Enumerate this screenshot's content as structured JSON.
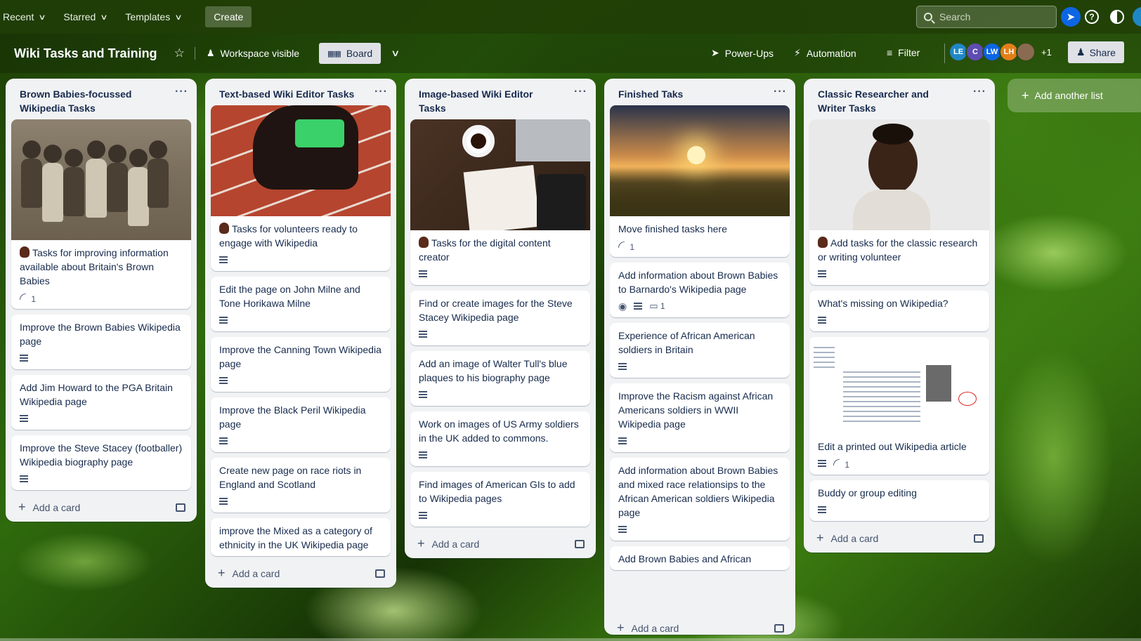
{
  "topbar": {
    "nav": [
      {
        "label": "Recent"
      },
      {
        "label": "Starred"
      },
      {
        "label": "Templates"
      }
    ],
    "create_label": "Create",
    "search_placeholder": "Search"
  },
  "board": {
    "title": "Wiki Tasks and Training",
    "visibility_label": "Workspace visible",
    "view_label": "Board",
    "powerups_label": "Power-Ups",
    "automation_label": "Automation",
    "filter_label": "Filter",
    "members": [
      {
        "initials": "LE",
        "color": "#1e88c7"
      },
      {
        "initials": "C",
        "color": "#5e4db2"
      },
      {
        "initials": "LW",
        "color": "#0c66e4"
      },
      {
        "initials": "LH",
        "color": "#e2801a"
      },
      {
        "initials": "",
        "color": "#8a6b52"
      }
    ],
    "more_members": "+1",
    "share_label": "Share",
    "add_list_label": "Add another list"
  },
  "lists": [
    {
      "title": "Brown Babies-focussed Wikipedia Tasks",
      "add_card_label": "Add a card",
      "cards": [
        {
          "text": "Tasks for improving information available about Britain's Brown Babies",
          "cover": "sepia",
          "hand": true,
          "attachments": "1"
        },
        {
          "text": "Improve the Brown Babies Wikipedia page",
          "description": true
        },
        {
          "text": "Add Jim Howard to the PGA Britain Wikipedia page",
          "description": true
        },
        {
          "text": "Improve the Steve Stacey (footballer) Wikipedia biography page",
          "description": true
        }
      ]
    },
    {
      "title": "Text-based Wiki Editor Tasks",
      "add_card_label": "Add a card",
      "cards": [
        {
          "text": "Tasks for volunteers ready to engage with Wikipedia",
          "cover": "track",
          "hand": true,
          "description": true
        },
        {
          "text": "Edit the page on John Milne and Tone Horikawa Milne",
          "description": true
        },
        {
          "text": "Improve the Canning Town Wikipedia page",
          "description": true
        },
        {
          "text": "Improve the Black Peril Wikipedia page",
          "description": true
        },
        {
          "text": "Create new page on race riots in England and Scotland",
          "description": true
        },
        {
          "text": "improve the Mixed as a category of ethnicity in the UK Wikipedia page"
        }
      ]
    },
    {
      "title": "Image-based Wiki Editor Tasks",
      "add_card_label": "Add a card",
      "cards": [
        {
          "text": "Tasks for the digital content creator",
          "cover": "desk",
          "hand": true,
          "description": true
        },
        {
          "text": "Find or create images for the Steve Stacey Wikipedia page",
          "description": true
        },
        {
          "text": "Add an image of Walter Tull's blue plaques to his biography page",
          "description": true
        },
        {
          "text": "Work on images of US Army soldiers in the UK added to commons.",
          "description": true
        },
        {
          "text": "Find images of American GIs to add to Wikipedia pages",
          "description": true
        }
      ]
    },
    {
      "title": "Finished Taks",
      "add_card_label": "Add a card",
      "cards": [
        {
          "text": "Move finished tasks here",
          "cover": "sunset",
          "attachments": "1"
        },
        {
          "text": "Add information about Brown Babies to Barnardo's Wikipedia page",
          "watch": true,
          "description": true,
          "comments": "1"
        },
        {
          "text": "Experience of African American soldiers in Britain",
          "description": true
        },
        {
          "text": "Improve the Racism against African Americans soldiers in WWII Wikipedia page",
          "description": true
        },
        {
          "text": "Add information about Brown Babies and mixed race relationsips to the African American soldiers Wikipedia page",
          "description": true
        },
        {
          "text": "Add Brown Babies and African"
        }
      ]
    },
    {
      "title": "Classic Researcher and Writer Tasks",
      "add_card_label": "Add a card",
      "cards": [
        {
          "text": "Add tasks for the classic research or writing volunteer",
          "cover": "portrait",
          "hand": true,
          "description": true
        },
        {
          "text": "What's missing on Wikipedia?",
          "description": true
        },
        {
          "text": "Edit a printed out Wikipedia article",
          "cover": "wikipage",
          "description": true,
          "attachments": "1"
        },
        {
          "text": "Buddy or group editing",
          "description": true
        }
      ]
    }
  ],
  "colors": {
    "topbar": "#1f3d06",
    "list_bg": "#f1f2f4",
    "text": "#172b4d",
    "secondary": "#44546f"
  }
}
